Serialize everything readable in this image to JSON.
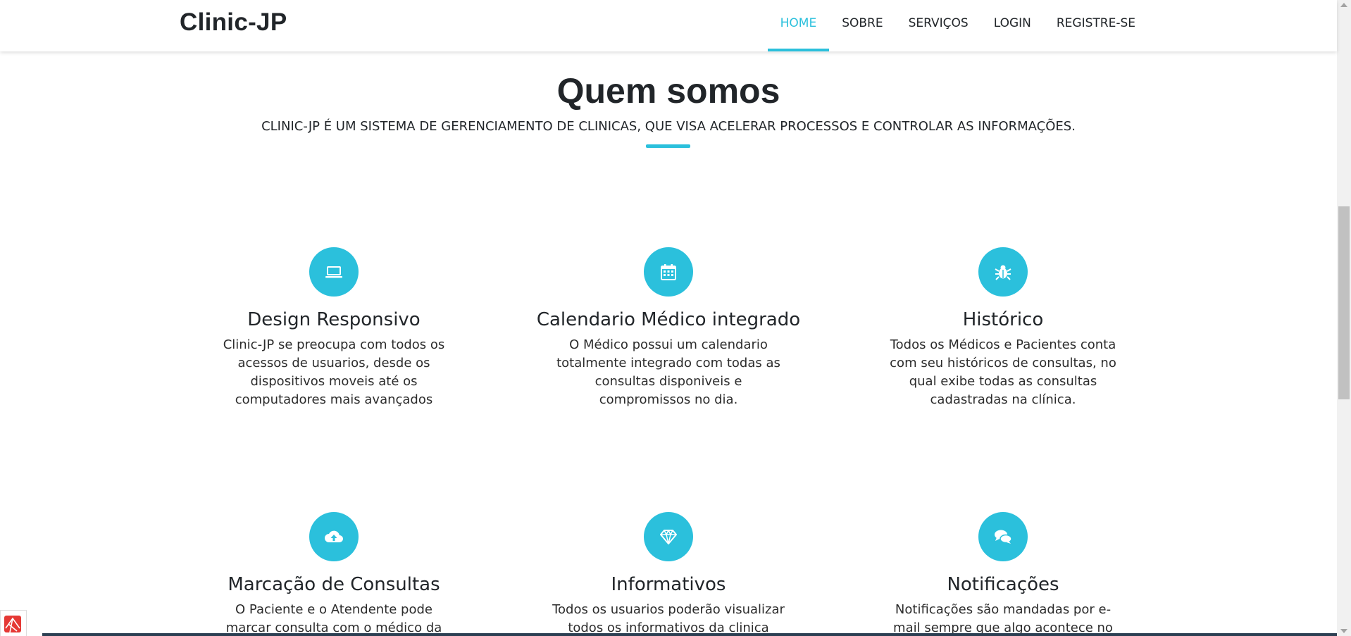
{
  "navbar": {
    "brand": "Clinic-JP",
    "links": [
      {
        "label": "HOME",
        "active": true
      },
      {
        "label": "SOBRE",
        "active": false
      },
      {
        "label": "SERVIÇOS",
        "active": false
      },
      {
        "label": "LOGIN",
        "active": false
      },
      {
        "label": "REGISTRE-SE",
        "active": false
      }
    ]
  },
  "about": {
    "title": "Quem somos",
    "subtitle": "CLINIC-JP É UM SISTEMA DE GERENCIAMENTO DE CLINICAS, QUE VISA ACELERAR PROCESSOS E CONTROLAR AS INFORMAÇÕES."
  },
  "features": [
    {
      "icon": "laptop-icon",
      "title": "Design Responsivo",
      "text": "Clinic-JP se preocupa com todos os acessos de usuarios, desde os dispositivos moveis até os computadores mais avançados"
    },
    {
      "icon": "calendar-icon",
      "title": "Calendario Médico integrado",
      "text": "O Médico possui um calendario totalmente integrado com todas as consultas disponiveis e compromissos no dia."
    },
    {
      "icon": "bug-icon",
      "title": "Histórico",
      "text": "Todos os Médicos e Pacientes conta com seu históricos de consultas, no qual exibe todas as consultas cadastradas na clínica."
    },
    {
      "icon": "cloud-upload-icon",
      "title": "Marcação de Consultas",
      "text": "O Paciente e o Atendente pode marcar consulta com o médico da"
    },
    {
      "icon": "diamond-icon",
      "title": "Informativos",
      "text": "Todos os usuarios poderão visualizar todos os informativos da clinica"
    },
    {
      "icon": "comments-icon",
      "title": "Notificações",
      "text": "Notificações são mandadas por e-mail sempre que algo acontece no"
    }
  ],
  "colors": {
    "accent": "#2bc0dc",
    "text": "#212529"
  }
}
